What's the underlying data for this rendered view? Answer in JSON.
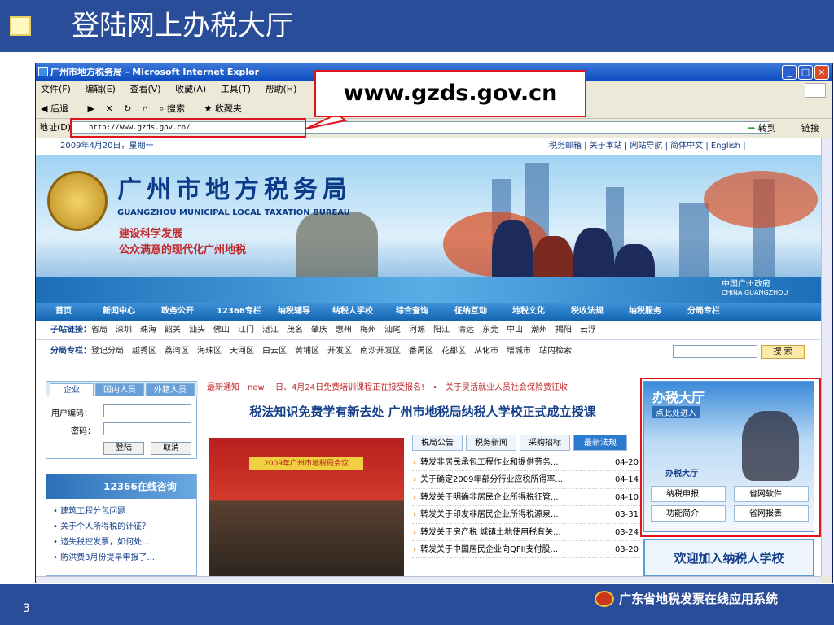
{
  "slide": {
    "title": "登陆网上办税大厅",
    "page": "3",
    "footer_brand": "广东省地税发票在线应用系统",
    "url_callout": "www.gzds.gov.cn"
  },
  "browser": {
    "title": "广州市地方税务局 - Microsoft Internet Explor",
    "menu": [
      "文件(F)",
      "编辑(E)",
      "查看(V)",
      "收藏(A)",
      "工具(T)",
      "帮助(H)"
    ],
    "toolbar": {
      "back": "后退",
      "search": "搜索",
      "favorites": "收藏夹"
    },
    "address_label": "地址(D)",
    "address_value": "http://www.gzds.gov.cn/",
    "go": "转到",
    "links": "链接"
  },
  "site": {
    "date": "2009年4月20日，星期一",
    "top_links": "税务邮箱 | 关于本站 | 网站导航 | 简体中文 | English |",
    "bureau_cn": "广州市地方税务局",
    "bureau_en": "GUANGZHOU MUNICIPAL LOCAL TAXATION BUREAU",
    "slogan1": "建设科学发展",
    "slogan2": "公众满意的现代化广州地税",
    "cgov1": "中国广州政府",
    "cgov2": "CHINA GUANGZHOU",
    "nav": [
      "首页",
      "新闻中心",
      "政务公开",
      "12366专栏",
      "纳税辅导",
      "纳税人学校",
      "综合查询",
      "征纳互动",
      "地税文化",
      "税收法规",
      "纳税服务",
      "分局专栏"
    ],
    "sublinks_label": "子站链接：",
    "sublinks": "省局　深圳　珠海　韶关　汕头　佛山　江门　湛江　茂名　肇庆　惠州　梅州　汕尾　河源　阳江　清远　东莞　中山　潮州　揭阳　云浮",
    "branch_label": "分局专栏：",
    "branch": "登记分局　越秀区　荔湾区　海珠区　天河区　白云区　黄埔区　开发区　南沙开发区　番禺区　花都区　从化市　增城市　站内检索",
    "search_btn": "搜 索",
    "login": {
      "tabs": [
        "企业",
        "国内人员",
        "外籍人员"
      ],
      "user": "用户编码：",
      "pwd": "密码：",
      "login": "登陆",
      "cancel": "取消"
    },
    "hotline": "12366在线咨询",
    "questions": [
      "建筑工程分包问题",
      "关于个人所得税的计征？",
      "遗失税控发票，如何处...",
      "防洪费3月份提早申报了..."
    ],
    "notice": "最新通知　new　:日、4月24日免费培训课程正在接受报名!　•　关于灵活就业人员社会保险费征收",
    "headline": "税法知识免费学有新去处 广州市地税局纳税人学校正式成立授课",
    "photo_banner": "2009年广州市地税局会议",
    "news_tabs": [
      "税局公告",
      "税务新闻",
      "采购招标",
      "最新法规"
    ],
    "news": [
      {
        "t": "转发非居民承包工程作业和提供劳务...",
        "d": "04-20"
      },
      {
        "t": "关于确定2009年部分行业应税所得率...",
        "d": "04-14"
      },
      {
        "t": "转发关于明确非居民企业所得税征管...",
        "d": "04-10"
      },
      {
        "t": "转发关于印发非居民企业所得税源泉...",
        "d": "03-31"
      },
      {
        "t": "转发关于房产税 城镇土地使用税有关...",
        "d": "03-24"
      },
      {
        "t": "转发关于中国居民企业向QFII支付股...",
        "d": "03-20"
      }
    ],
    "hall": {
      "title": "办税大厅",
      "enter": "点此处进入",
      "sub": "办税大厅",
      "buttons": [
        "纳税申报",
        "省网软件",
        "功能简介",
        "省网报表"
      ]
    },
    "welcome": "欢迎加入纳税人学校"
  }
}
